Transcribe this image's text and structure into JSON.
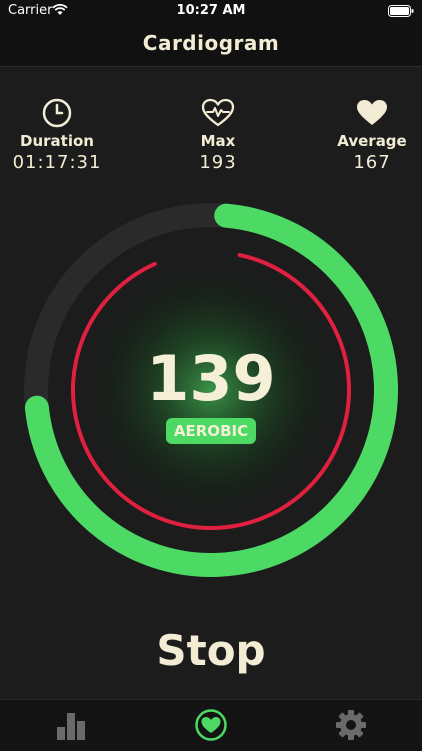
{
  "status": {
    "carrier": "Carrier",
    "time": "10:27 AM"
  },
  "nav": {
    "title": "Cardiogram"
  },
  "stats": {
    "duration": {
      "label": "Duration",
      "value": "01:17:31",
      "icon": "clock-icon"
    },
    "max": {
      "label": "Max",
      "value": "193",
      "icon": "heart-pulse-icon"
    },
    "average": {
      "label": "Average",
      "value": "167",
      "icon": "heart-filled-icon"
    }
  },
  "heart_rate": {
    "current": "139",
    "zone": "AEROBIC",
    "max_bpm": 193,
    "outer_ring_progress": 0.72,
    "inner_ring_progress": 0.9
  },
  "actions": {
    "stop_label": "Stop"
  },
  "tabs": [
    {
      "name": "stats",
      "icon": "bar-chart-icon"
    },
    {
      "name": "heart",
      "icon": "heart-tab-icon",
      "selected": true
    },
    {
      "name": "settings",
      "icon": "gear-icon"
    }
  ],
  "colors": {
    "background": "#1c1c1c",
    "accent_green": "#4cd964",
    "ring_red": "#e0203f",
    "text_cream": "#f3ecd4",
    "ring_track": "#2a2a2a"
  }
}
